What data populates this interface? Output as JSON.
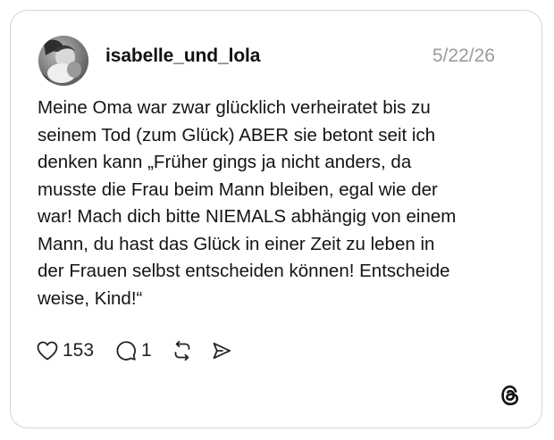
{
  "post": {
    "username": "isabelle_und_lola",
    "date": "5/22/26",
    "text_lines": [
      "Meine Oma war zwar glücklich verheiratet bis zu",
      "seinem Tod (zum Glück) ABER sie betont seit ich",
      "denken kann „Früher gings ja nicht anders, da",
      "musste die Frau beim Mann bleiben, egal wie der",
      "war! Mach dich bitte NIEMALS abhängig von einem",
      "Mann, du hast das Glück in einer Zeit zu leben in",
      "der Frauen selbst entscheiden können! Entscheide",
      "weise, Kind!“"
    ]
  },
  "actions": {
    "likes": "153",
    "replies": "1"
  },
  "icons": {
    "like": "heart-icon",
    "reply": "comment-bubble-icon",
    "repost": "repost-icon",
    "share": "send-icon",
    "brand": "threads-logo-icon"
  },
  "colors": {
    "text": "#141414",
    "muted": "#9b9b9b",
    "border": "#d4d4d4"
  }
}
